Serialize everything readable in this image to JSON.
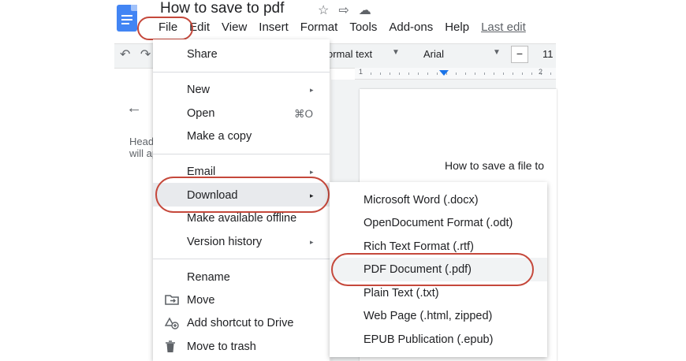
{
  "document": {
    "title": "How to save to pdf",
    "page_text": "How to save a file to",
    "outline_back": "←",
    "outline_text_1": "Headings you add to the document",
    "outline_text_2": "will appear here"
  },
  "title_icons": {
    "star": "☆",
    "move": "⇨",
    "cloud": "☁"
  },
  "menubar": {
    "items": [
      "File",
      "Edit",
      "View",
      "Insert",
      "Format",
      "Tools",
      "Add-ons",
      "Help"
    ],
    "last_edit": "Last edit"
  },
  "toolbar": {
    "undo": "↶",
    "redo": "↷",
    "style": "ormal text",
    "font": "Arial",
    "minus": "−",
    "size": "11"
  },
  "ruler": {
    "label_1": "1",
    "label_2": "2"
  },
  "file_menu": {
    "share": "Share",
    "new": "New",
    "open": "Open",
    "open_shortcut": "⌘O",
    "make_copy": "Make a copy",
    "email": "Email",
    "download": "Download",
    "make_offline": "Make available offline",
    "version_history": "Version history",
    "rename": "Rename",
    "move": "Move",
    "add_shortcut": "Add shortcut to Drive",
    "move_trash": "Move to trash",
    "arrow": "▸",
    "icons": {
      "move": "move-to-folder-icon",
      "shortcut": "add-shortcut-icon",
      "trash": "trash-icon"
    }
  },
  "download_menu": {
    "items": [
      "Microsoft Word (.docx)",
      "OpenDocument Format (.odt)",
      "Rich Text Format (.rtf)",
      "PDF Document (.pdf)",
      "Plain Text (.txt)",
      "Web Page (.html, zipped)",
      "EPUB Publication (.epub)"
    ]
  },
  "colors": {
    "annotation": "#c5483b",
    "docs_blue": "#4285f4",
    "ruler_marker": "#1a73e8"
  }
}
